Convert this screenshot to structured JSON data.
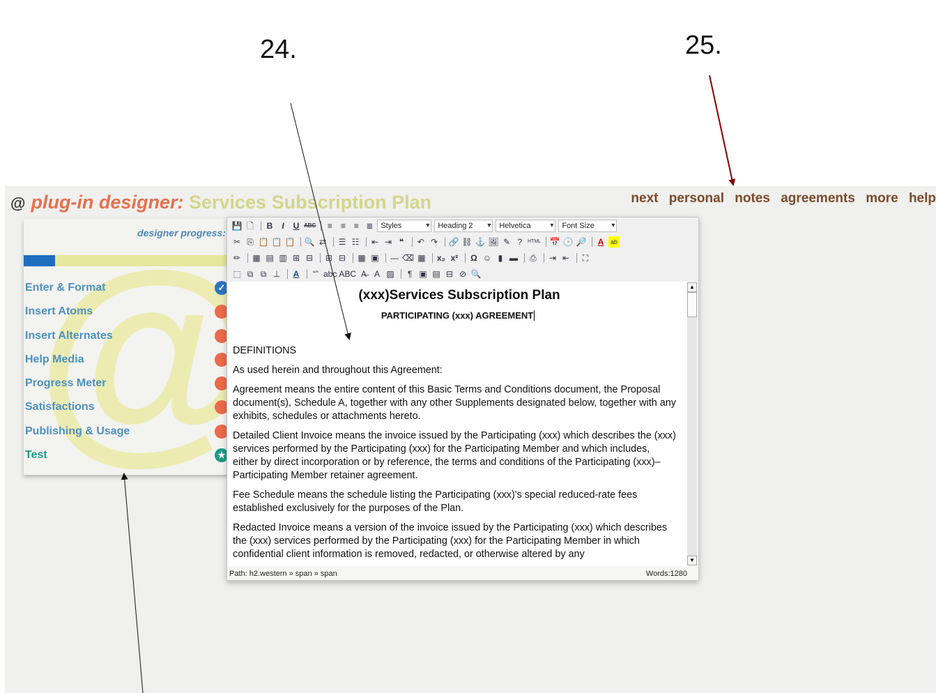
{
  "annotations": {
    "label_24": "24.",
    "label_25": "25."
  },
  "header": {
    "at": "@",
    "prefix": "plug-in designer:",
    "title": "Services Subscription Plan"
  },
  "nav": [
    "next",
    "personal",
    "notes",
    "agreements",
    "more",
    "help"
  ],
  "sidebar": {
    "progress_label": "designer progress:",
    "progress_fraction": 0.15,
    "steps": [
      {
        "label": "Enter & Format",
        "status": "done"
      },
      {
        "label": "Insert Atoms",
        "status": "todo"
      },
      {
        "label": "Insert Alternates",
        "status": "todo"
      },
      {
        "label": "Help Media",
        "status": "todo"
      },
      {
        "label": "Progress Meter",
        "status": "todo"
      },
      {
        "label": "Satisfactions",
        "status": "todo"
      },
      {
        "label": "Publishing & Usage",
        "status": "todo"
      },
      {
        "label": "Test",
        "status": "star"
      }
    ]
  },
  "editor": {
    "styles_select": "Styles",
    "format_select": "Heading 2",
    "font_select": "Helvetica",
    "size_select": "Font Size",
    "doc_title": "(xxx)Services Subscription Plan",
    "doc_subtitle": "PARTICIPATING (xxx) AGREEMENT",
    "paragraphs": [
      "DEFINITIONS",
      "As used herein and throughout this Agreement:",
      "Agreement means the entire content of this Basic Terms and Conditions document, the Proposal document(s), Schedule A, together with any other Supplements designated below, together with any exhibits, schedules or attachments hereto.",
      "Detailed Client Invoice means the invoice issued by the Participating (xxx) which describes the (xxx) services performed by the Participating (xxx) for the Participating Member and which includes, either by direct incorporation or by reference, the terms and conditions of the Participating (xxx)–Participating Member retainer agreement.",
      "Fee Schedule means the schedule listing the Participating (xxx)'s special reduced-rate fees established exclusively for the purposes of the Plan.",
      "Redacted Invoice means a version of the invoice issued by the Participating (xxx) which describes the (xxx) services performed by the Participating (xxx) for the Participating Member in which confidential client information is removed, redacted, or otherwise altered by any"
    ],
    "status_path": "Path: h2.western » span » span",
    "status_words": "Words:1280"
  },
  "toolbar_icons": {
    "bold": "B",
    "italic": "I",
    "underline": "U",
    "strike": "ABC",
    "html": "HTML",
    "omega": "Ω",
    "subscript": "x₂",
    "superscript": "x²",
    "quote": "❝",
    "pilcrow": "¶"
  },
  "colors": {
    "accent_orange": "#e8704f",
    "title_yellow": "#d4d68c",
    "nav_brown": "#7a4a2a",
    "link_blue": "#4d91bf",
    "arrow_red": "#8b0000"
  }
}
